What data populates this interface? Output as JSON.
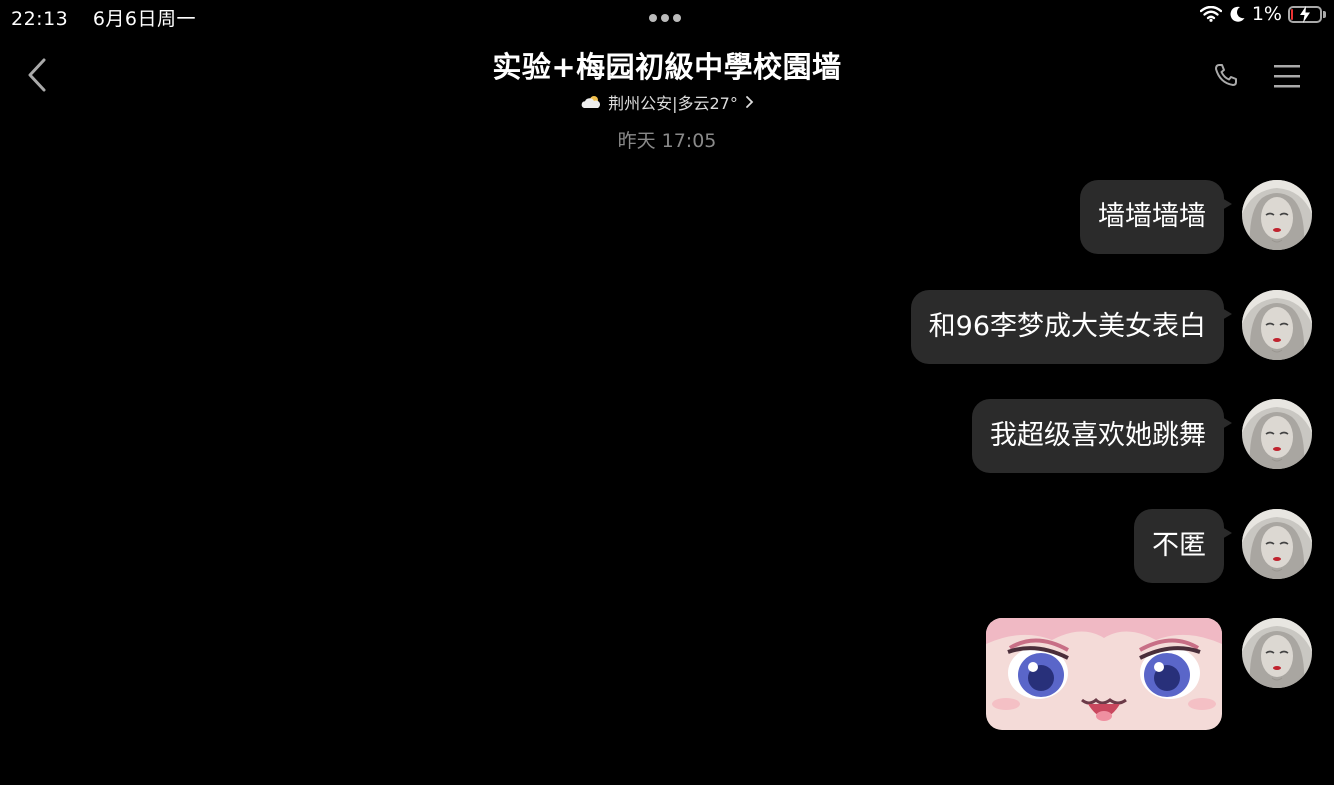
{
  "status": {
    "time": "22:13",
    "date": "6月6日周一",
    "battery_pct": "1%",
    "icons": [
      "wifi-icon",
      "moon-icon",
      "battery-charging-icon"
    ]
  },
  "header": {
    "title": "实验+梅园初級中學校園墙",
    "subtitle": "荆州公安|多云27°",
    "weather_icon": "cloud-icon",
    "back_icon": "chevron-left-icon",
    "call_icon": "phone-icon",
    "menu_icon": "menu-icon"
  },
  "chat": {
    "timestamp": "昨天 17:05",
    "messages": [
      {
        "text": "墙墙墙墙"
      },
      {
        "text": "和96李梦成大美女表白"
      },
      {
        "text": "我超级喜欢她跳舞"
      },
      {
        "text": "不匿"
      },
      {
        "type": "sticker"
      }
    ]
  },
  "colors": {
    "background": "#000000",
    "bubble": "#2b2b2b",
    "timestamp": "#8a8a8a"
  }
}
